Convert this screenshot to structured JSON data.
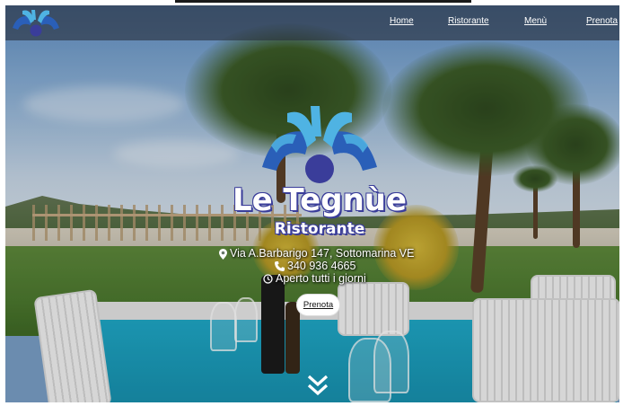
{
  "nav": {
    "items": [
      {
        "label": "Home"
      },
      {
        "label": "Ristorante"
      },
      {
        "label": "Menù"
      },
      {
        "label": "Prenota"
      }
    ]
  },
  "hero": {
    "brand_name": "Le Tegnùe",
    "brand_subtitle": "Ristorante",
    "address": "Via A.Barbarigo 147, Sottomarina VE",
    "phone": "340 936 4665",
    "hours": "Aperto tutti i giorni",
    "book_button": "Prenota"
  },
  "icons": {
    "address": "map-marker-icon",
    "phone": "phone-icon",
    "hours": "clock-icon",
    "scroll": "double-chevron-down-icon"
  },
  "colors": {
    "logo_light_blue": "#4fb3e3",
    "logo_dark_blue": "#2a5fb8",
    "logo_purple": "#3a3d9a",
    "navbar": "#282e3c"
  }
}
